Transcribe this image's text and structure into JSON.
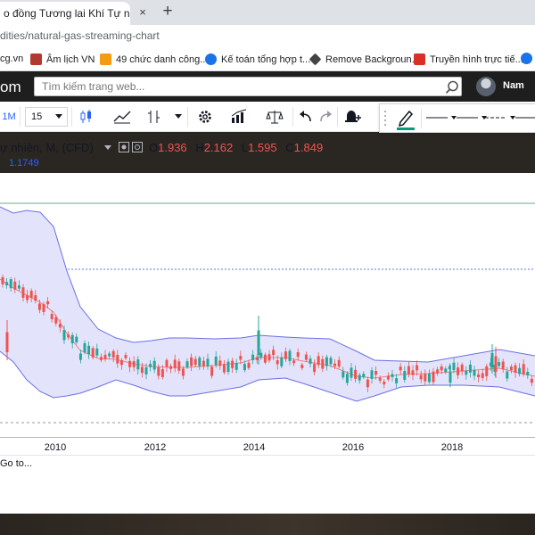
{
  "browser": {
    "tab_title": "o đồng Tương lai Khí Tự nhiê",
    "tab_close": "×",
    "new_tab": "+",
    "url": "dities/natural-gas-streaming-chart"
  },
  "bookmarks": [
    {
      "label": "cg.vn",
      "color": "#c0392b"
    },
    {
      "label": "Âm lịch VN",
      "color": "#b03a2e"
    },
    {
      "label": "49 chức danh công...",
      "color": "#f39c12"
    },
    {
      "label": "Kế toán tổng hợp t...",
      "color": "#1a73e8"
    },
    {
      "label": "Remove Backgroun...",
      "color": "#444444"
    },
    {
      "label": "Truyền hình trực tiế...",
      "color": "#d93025"
    }
  ],
  "site": {
    "logo": "om",
    "search_placeholder": "Tìm kiếm trang web...",
    "user": "Nam"
  },
  "toolbar": {
    "interval_label": "1M",
    "interval_value": "15"
  },
  "legend": {
    "symbol": "ự nhiên, M, (CFD)",
    "open_label": "O",
    "open": "1.936",
    "high_label": "H",
    "high": "2.162",
    "low_label": "L",
    "low": "1.595",
    "close_label": "C",
    "close": "1.849",
    "indicator_value": "1.1749"
  },
  "colors": {
    "up": "#26a69a",
    "down": "#ef5350",
    "band_line": "#6a6fe6",
    "band_fill": "#e3e4fb",
    "basis": "#ef7f7f",
    "hline_green": "#52b68d",
    "hline_blue": "#6a6fe6"
  },
  "xaxis_labels": [
    "2010",
    "2012",
    "2014",
    "2016",
    "2018"
  ],
  "goto_label": "Go to..."
}
